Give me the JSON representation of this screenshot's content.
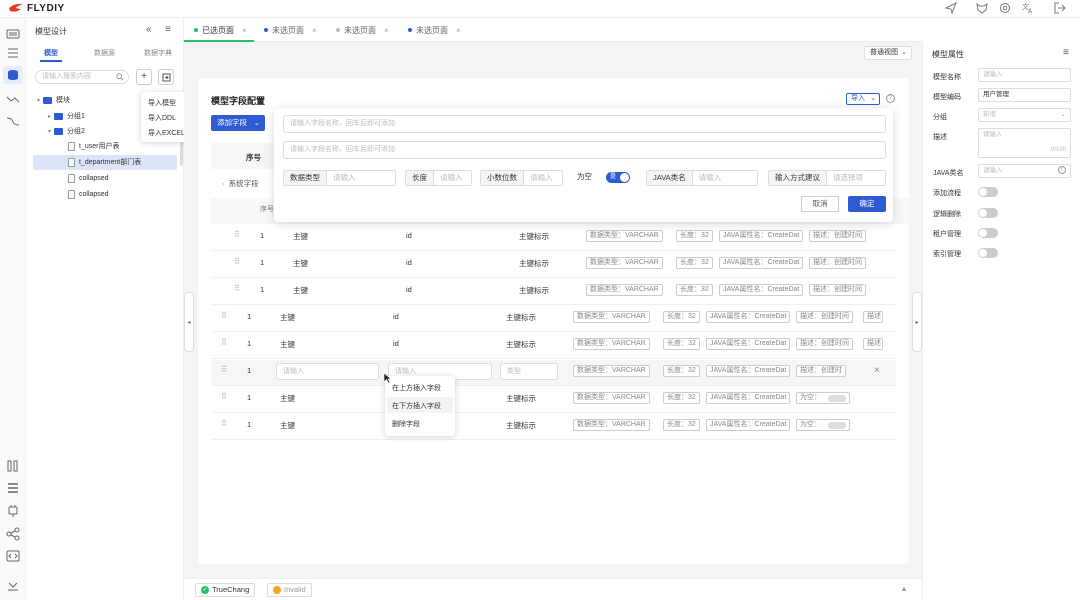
{
  "app": {
    "name": "FLYDIY"
  },
  "panel": {
    "title": "模型设计",
    "tabs": [
      "模型",
      "数据源",
      "数据字典"
    ],
    "search_placeholder": "请输入搜索内容",
    "tree": [
      {
        "label": "模块"
      },
      {
        "label": "分组1"
      },
      {
        "label": "分组2"
      },
      {
        "label": "t_user用户表"
      },
      {
        "label": "t_department部门表"
      },
      {
        "label": "collapsed"
      },
      {
        "label": "collapsed"
      }
    ]
  },
  "import_menu": [
    "导入模型",
    "导入DDL",
    "导入EXCEL"
  ],
  "page_tabs": [
    {
      "label": "已选页面",
      "color": "#22c55e"
    },
    {
      "label": "未选页面",
      "color": "#2e5bd3"
    },
    {
      "label": "未选页面",
      "color": "#bbbbbb"
    },
    {
      "label": "未选页面",
      "color": "#2e5bd3"
    }
  ],
  "view_select": "普通视图",
  "card": {
    "title": "模型字段配置",
    "import_button": "导入",
    "add_field_button": "添加字段",
    "header_seq": "序号",
    "system_field": "系统字段",
    "sub_header_seq": "序号"
  },
  "popup": {
    "input1_placeholder": "请输入字段名称，回车后即可添加",
    "input2_placeholder": "请输入字段名称，回车后即可添加",
    "data_type_label": "数据类型",
    "data_type_placeholder": "请输入",
    "length_label": "长度",
    "length_placeholder": "请输入",
    "decimal_label": "小数位数",
    "decimal_placeholder": "请输入",
    "nullable_label": "为空",
    "nullable_value": "是",
    "java_type_label": "JAVA类名",
    "java_type_placeholder": "请输入",
    "input_mode_label": "输入方式建议",
    "input_mode_placeholder": "请选择项",
    "cancel": "取消",
    "confirm": "确定"
  },
  "rows": [
    {
      "seq": "1",
      "name": "主键",
      "code": "id",
      "desc": "主键标示",
      "chips": [
        "数据类型：VARCHAR",
        "长度：32",
        "JAVA属性名：CreateDat",
        "描述：创建时间"
      ]
    },
    {
      "seq": "1",
      "name": "主键",
      "code": "id",
      "desc": "主键标示",
      "chips": [
        "数据类型：VARCHAR",
        "长度：32",
        "JAVA属性名：CreateDat",
        "描述：创建时间"
      ]
    },
    {
      "seq": "1",
      "name": "主键",
      "code": "id",
      "desc": "主键标示",
      "chips": [
        "数据类型：VARCHAR",
        "长度：32",
        "JAVA属性名：CreateDat",
        "描述：创建时间"
      ]
    },
    {
      "seq": "1",
      "name": "主键",
      "code": "id",
      "desc": "主键标示",
      "chips": [
        "数据类型：VARCHAR",
        "长度：32",
        "JAVA属性名：CreateDat",
        "描述：创建时间",
        "描述"
      ]
    },
    {
      "seq": "1",
      "name": "主键",
      "code": "id",
      "desc": "主键标示",
      "chips": [
        "数据类型：VARCHAR",
        "长度：32",
        "JAVA属性名：CreateDat",
        "描述：创建时间",
        "描述"
      ]
    },
    {
      "seq": "1",
      "name": "请输入",
      "code": "请输入",
      "desc": "类型",
      "chips": [
        "数据类型：VARCHAR",
        "长度：32",
        "JAVA属性名：CreateDat",
        "描述：创建时"
      ]
    },
    {
      "seq": "1",
      "name": "主键",
      "code": "",
      "desc": "主键标示",
      "chips": [
        "数据类型：VARCHAR",
        "长度：32",
        "JAVA属性名：CreateDat",
        "为空："
      ]
    },
    {
      "seq": "1",
      "name": "主键",
      "code": "",
      "desc": "主键标示",
      "chips": [
        "数据类型：VARCHAR",
        "长度：32",
        "JAVA属性名：CreateDat",
        "为空："
      ]
    }
  ],
  "context_menu": [
    "在上方插入字段",
    "在下方插入字段",
    "删除字段"
  ],
  "right_panel": {
    "title": "模型属性",
    "model_name_label": "模型名称",
    "model_name_placeholder": "请输入",
    "model_code_label": "模型编码",
    "model_code_value": "用户管理",
    "group_label": "分组",
    "group_placeholder": "新增",
    "desc_label": "描述",
    "desc_placeholder": "请输入",
    "desc_count": "0/100",
    "java_label": "JAVA类名",
    "java_placeholder": "请输入",
    "toggles": [
      "添加流程",
      "逻辑删除",
      "租户管理",
      "索引管理"
    ]
  },
  "bottom": {
    "btn1": "TrueChang",
    "btn2": "Invalid"
  },
  "colors": {
    "accent": "#2e5bd3",
    "green": "#22c55e",
    "orange": "#f5a623"
  }
}
